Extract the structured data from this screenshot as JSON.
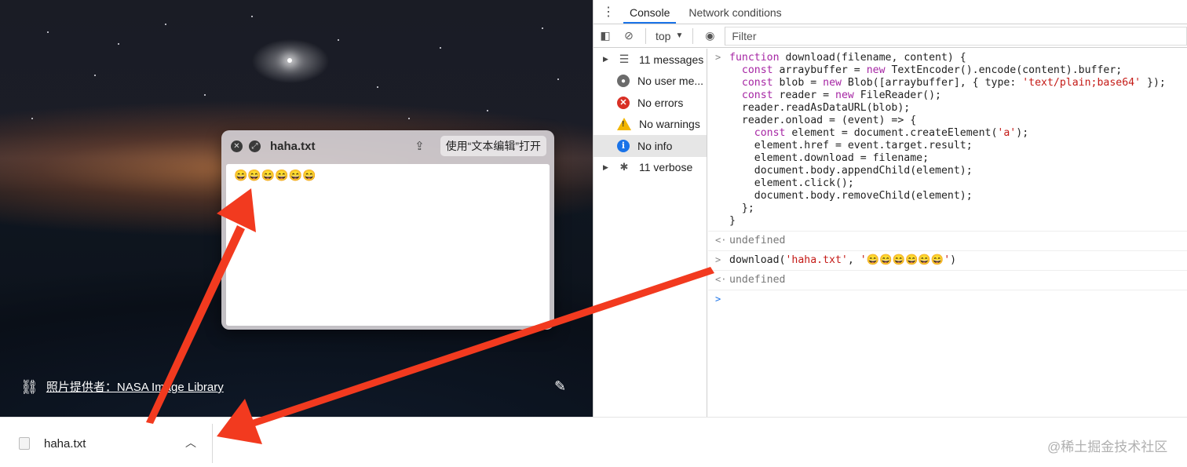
{
  "photo": {
    "credit_label": "照片提供者：NASA Image Library"
  },
  "quicklook": {
    "title": "haha.txt",
    "open_with_label": "使用“文本编辑”打开",
    "content": "😄😄😄😄😄😄"
  },
  "devtools": {
    "tabs": [
      {
        "label": "Console"
      },
      {
        "label": "Network conditions"
      }
    ],
    "toolbar": {
      "context": "top",
      "filter_placeholder": "Filter"
    },
    "sidebar": {
      "items": [
        {
          "label": "11 messages",
          "icon": "list-icon"
        },
        {
          "label": "No user me...",
          "icon": "user-icon"
        },
        {
          "label": "No errors",
          "icon": "error-icon"
        },
        {
          "label": "No warnings",
          "icon": "warning-icon"
        },
        {
          "label": "No info",
          "icon": "info-icon"
        },
        {
          "label": "11 verbose",
          "icon": "bug-icon"
        }
      ]
    },
    "console": {
      "undefined_label": "undefined",
      "second_input_prefix": "download(",
      "second_input_arg1": "'haha.txt'",
      "second_input_sep": ", ",
      "second_input_arg2": "'😄😄😄😄😄😄'",
      "second_input_suffix": ")"
    }
  },
  "download_bar": {
    "file_name": "haha.txt"
  },
  "watermark": "@稀土掘金技术社区",
  "colors": {
    "accent": "#1a73e8",
    "arrow": "#f23a1f",
    "error": "#d93025",
    "warning": "#f2b600"
  }
}
